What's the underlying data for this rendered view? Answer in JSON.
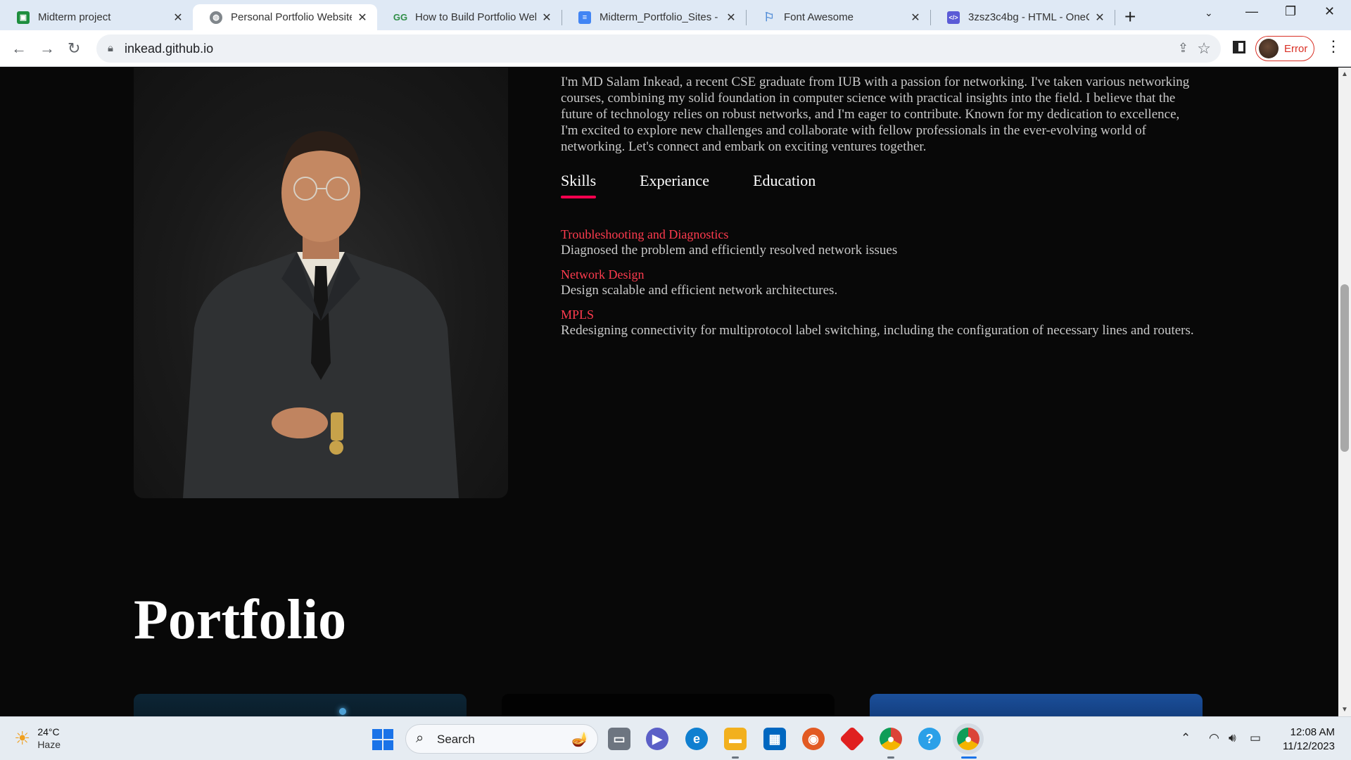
{
  "browser": {
    "tabs": [
      {
        "title": "Midterm project",
        "icon": "google-classroom-icon",
        "color": "#1e8e3e",
        "active": false
      },
      {
        "title": "Personal Portfolio Website",
        "icon": "globe-icon",
        "color": "#5f6368",
        "active": true
      },
      {
        "title": "How to Build Portfolio Wel",
        "icon": "geeksforgeeks-icon",
        "color": "#2f8d46",
        "active": false
      },
      {
        "title": "Midterm_Portfolio_Sites - C",
        "icon": "google-docs-icon",
        "color": "#4285f4",
        "active": false
      },
      {
        "title": "Font Awesome",
        "icon": "flag-icon",
        "color": "#528dd7",
        "active": false
      },
      {
        "title": "3zsz3c4bg - HTML - OneC",
        "icon": "code-icon",
        "color": "#5b5bd6",
        "active": false
      }
    ],
    "url": "inkead.github.io",
    "profile_status": "Error"
  },
  "page": {
    "about_text": "I'm MD Salam Inkead, a recent CSE graduate from IUB with a passion for networking. I've taken various networking courses, combining my solid foundation in computer science with practical insights into the field. I believe that the future of technology relies on robust networks, and I'm eager to contribute. Known for my dedication to excellence, I'm excited to explore new challenges and collaborate with fellow professionals in the ever-evolving world of networking. Let's connect and embark on exciting ventures together.",
    "tabs": [
      {
        "label": "Skills",
        "active": true
      },
      {
        "label": "Experiance",
        "active": false
      },
      {
        "label": "Education",
        "active": false
      }
    ],
    "skills": [
      {
        "title": "Troubleshooting and Diagnostics",
        "desc": "Diagnosed the problem and efficiently resolved network issues"
      },
      {
        "title": "Network Design",
        "desc": "Design scalable and efficient network architectures."
      },
      {
        "title": "MPLS",
        "desc": "Redesigning connectivity for multiprotocol label switching, including the configuration of necessary lines and routers."
      }
    ],
    "portfolio_heading": "Portfolio",
    "accent_color": "#ff004f"
  },
  "taskbar": {
    "weather_temp": "24°C",
    "weather_condition": "Haze",
    "search_label": "Search",
    "time": "12:08 AM",
    "date": "11/12/2023"
  }
}
